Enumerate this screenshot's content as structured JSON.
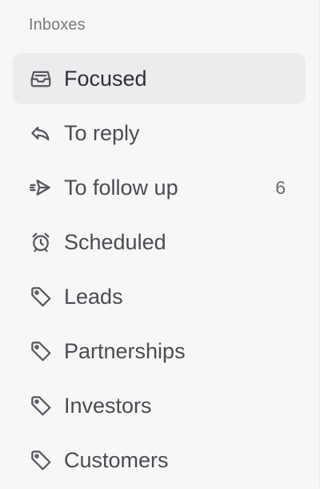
{
  "sidebar": {
    "section_title": "Inboxes",
    "items": [
      {
        "label": "Focused",
        "icon": "inbox-tray-icon",
        "active": true
      },
      {
        "label": "To reply",
        "icon": "reply-icon"
      },
      {
        "label": "To follow up",
        "icon": "send-icon",
        "count": "6"
      },
      {
        "label": "Scheduled",
        "icon": "alarm-clock-icon"
      },
      {
        "label": "Leads",
        "icon": "tag-icon"
      },
      {
        "label": "Partnerships",
        "icon": "tag-icon"
      },
      {
        "label": "Investors",
        "icon": "tag-icon"
      },
      {
        "label": "Customers",
        "icon": "tag-icon"
      }
    ]
  },
  "colors": {
    "sidebar_background": "#f7f7f8",
    "active_item_background": "#ececef",
    "text": "#4a4c52",
    "muted_text": "#7a7c82"
  }
}
